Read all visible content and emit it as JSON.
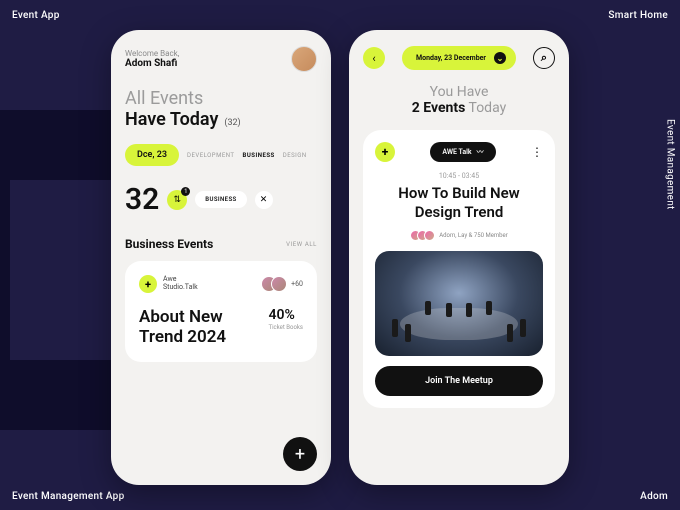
{
  "corners": {
    "top_left": "Event App",
    "top_right": "Smart Home",
    "bottom_left": "Event Management App",
    "bottom_right": "Adom",
    "side_right": "Event Management"
  },
  "phone1": {
    "welcome": "Welcome Back,",
    "user": "Adom Shafi",
    "headline_gray": "All Events",
    "headline_bold": "Have Today",
    "headline_count": "(32)",
    "date_pill": "Dce, 23",
    "tabs": {
      "dev": "DEVELOPMENT",
      "business": "BUSINESS",
      "design": "DESIGN"
    },
    "big_number": "32",
    "filter_badge": "1",
    "chip_label": "BUSINESS",
    "section_title": "Business Events",
    "view_all": "VIEW ALL",
    "card": {
      "tag_line1": "Awe",
      "tag_line2": "Studio.Talk",
      "plus_count": "+60",
      "title": "About New Trend 2024",
      "pct": "40%",
      "pct_label": "Ticket Books"
    }
  },
  "phone2": {
    "date_pill": "Monday, 23 December",
    "head_line1": "You Have",
    "head_bold": "2 Events",
    "head_gray": "Today",
    "card": {
      "pill": "AWE Talk",
      "time": "10:45 - 03:45",
      "title": "How To Build New Design Trend",
      "members_text": "Adom, Lay & 750 Member",
      "join": "Join The Meetup"
    }
  }
}
